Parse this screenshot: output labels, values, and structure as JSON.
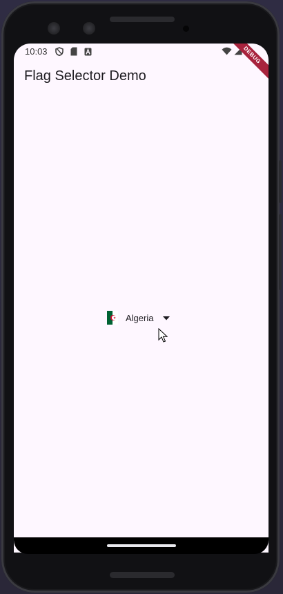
{
  "status_bar": {
    "time": "10:03",
    "left_icons": [
      "shield-icon",
      "sd-card-icon",
      "a-badge-icon"
    ],
    "right_icons": [
      "wifi-icon",
      "signal-icon",
      "battery-icon"
    ]
  },
  "debug_banner": "DEBUG",
  "app_bar": {
    "title": "Flag Selector Demo"
  },
  "country_dropdown": {
    "selected_value": "Algeria",
    "flag_icon": "algeria-flag-icon",
    "arrow_icon": "dropdown-arrow-icon"
  },
  "colors": {
    "screen_background": "#fef7ff",
    "debug_banner": "#a8233d",
    "flag_green": "#006233",
    "flag_white": "#ffffff",
    "flag_red": "#d21034"
  }
}
